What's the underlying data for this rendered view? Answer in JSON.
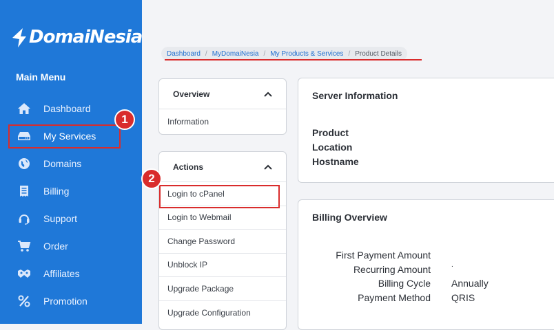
{
  "brand": {
    "name": "DomaiNesia"
  },
  "sidebar": {
    "menu_title": "Main Menu",
    "items": [
      {
        "label": "Dashboard",
        "icon": "home-icon"
      },
      {
        "label": "My Services",
        "icon": "server-icon"
      },
      {
        "label": "Domains",
        "icon": "globe-icon"
      },
      {
        "label": "Billing",
        "icon": "receipt-icon"
      },
      {
        "label": "Support",
        "icon": "headset-icon"
      },
      {
        "label": "Order",
        "icon": "cart-icon"
      },
      {
        "label": "Affiliates",
        "icon": "handshake-icon"
      },
      {
        "label": "Promotion",
        "icon": "percent-icon"
      }
    ]
  },
  "annotations": {
    "step1": "1",
    "step2": "2",
    "highlight_color": "#d92c2c"
  },
  "breadcrumb": {
    "items": [
      "Dashboard",
      "MyDomaiNesia",
      "My Products & Services"
    ],
    "current": "Product Details"
  },
  "overview_card": {
    "title": "Overview",
    "items": [
      "Information"
    ]
  },
  "actions_card": {
    "title": "Actions",
    "items": [
      "Login to cPanel",
      "Login to Webmail",
      "Change Password",
      "Unblock IP",
      "Upgrade Package",
      "Upgrade Configuration"
    ]
  },
  "server_info": {
    "title": "Server Information",
    "labels": [
      "Product",
      "Location",
      "Hostname"
    ]
  },
  "billing_overview": {
    "title": "Billing Overview",
    "rows": [
      {
        "label": "First Payment Amount",
        "value": ""
      },
      {
        "label": "Recurring Amount",
        "value": "."
      },
      {
        "label": "Billing Cycle",
        "value": "Annually"
      },
      {
        "label": "Payment Method",
        "value": "QRIS"
      }
    ]
  },
  "colors": {
    "sidebar": "#1f78d8",
    "link": "#1f6fd0",
    "accent": "#d92c2c"
  }
}
